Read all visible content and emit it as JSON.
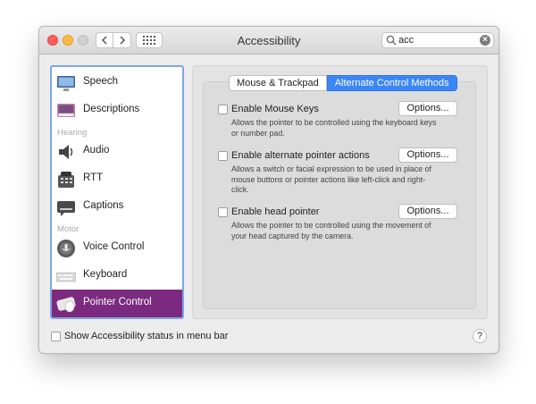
{
  "window": {
    "title": "Accessibility"
  },
  "search": {
    "value": "acc"
  },
  "sidebar": {
    "items": [
      {
        "label": "Speech",
        "icon": "speech-icon"
      },
      {
        "label": "Descriptions",
        "icon": "descriptions-icon"
      },
      {
        "label": "Audio",
        "icon": "speaker-icon"
      },
      {
        "label": "RTT",
        "icon": "telephone-icon"
      },
      {
        "label": "Captions",
        "icon": "captions-icon"
      },
      {
        "label": "Voice Control",
        "icon": "voice-control-icon"
      },
      {
        "label": "Keyboard",
        "icon": "keyboard-icon"
      },
      {
        "label": "Pointer Control",
        "icon": "pointer-icon",
        "selected": true
      }
    ],
    "headers": {
      "hearing": "Hearing",
      "motor": "Motor"
    }
  },
  "tabs": [
    {
      "label": "Mouse & Trackpad"
    },
    {
      "label": "Alternate Control Methods",
      "selected": true
    }
  ],
  "options": [
    {
      "title": "Enable Mouse Keys",
      "description": "Allows the pointer to be controlled using the keyboard keys or number pad.",
      "button": "Options..."
    },
    {
      "title": "Enable alternate pointer actions",
      "description": "Allows a switch or facial expression to be used in place of mouse buttons or pointer actions like left-click and right-click.",
      "button": "Options..."
    },
    {
      "title": "Enable head pointer",
      "description": "Allows the pointer to be controlled using the movement of your head captured by the camera.",
      "button": "Options..."
    }
  ],
  "footer": {
    "status_label": "Show Accessibility status in menu bar",
    "help": "?"
  },
  "colors": {
    "selection": "#7b2a7f",
    "tab_selected": "#3a86f7",
    "sidebar_border": "#7fa6e6"
  }
}
